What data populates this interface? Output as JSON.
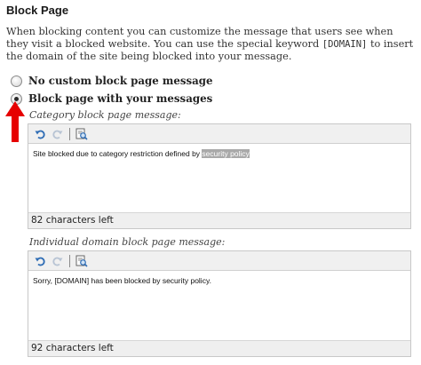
{
  "page": {
    "title": "Block Page",
    "description": {
      "part1": "When blocking content you can customize the message that users see when they visit a blocked website. You can use the special keyword ",
      "keyword": "[DOMAIN]",
      "part2": " to insert the domain of the site being blocked into your message."
    }
  },
  "options": [
    {
      "label": "No custom block page message",
      "selected": false
    },
    {
      "label": "Block page with your messages",
      "selected": true
    }
  ],
  "category_editor": {
    "label": "Category block page message:",
    "content_text": "Site blocked due to category restriction defined by ",
    "content_highlight": "security policy",
    "counter": "82 characters left"
  },
  "domain_editor": {
    "label": "Individual domain block page message:",
    "content_text": "Sorry, [DOMAIN] has been blocked by  security policy.",
    "counter": "92 characters left"
  },
  "toolbar_icons": [
    "undo-icon",
    "redo-icon",
    "find-replace-icon"
  ],
  "colors": {
    "arrow": "#e60000",
    "highlight": "#a9a9a9"
  }
}
